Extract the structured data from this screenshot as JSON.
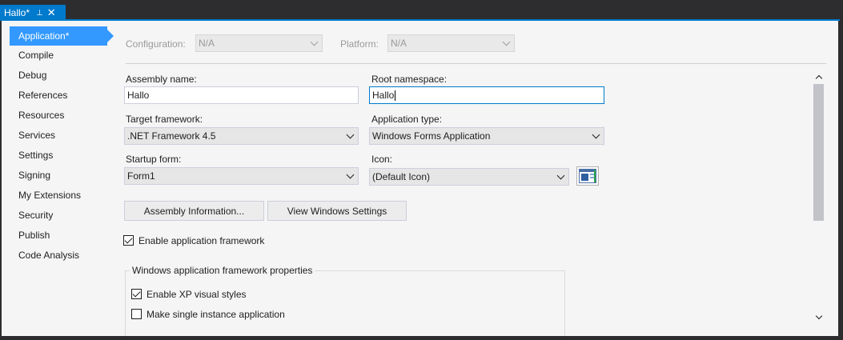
{
  "tab": {
    "title": "Hallo*",
    "pin_glyph": "⊣",
    "close_glyph": "✕"
  },
  "nav": {
    "items": [
      {
        "label": "Application*",
        "active": true
      },
      {
        "label": "Compile"
      },
      {
        "label": "Debug"
      },
      {
        "label": "References"
      },
      {
        "label": "Resources"
      },
      {
        "label": "Services"
      },
      {
        "label": "Settings"
      },
      {
        "label": "Signing"
      },
      {
        "label": "My Extensions"
      },
      {
        "label": "Security"
      },
      {
        "label": "Publish"
      },
      {
        "label": "Code Analysis"
      }
    ]
  },
  "config": {
    "configuration_label": "Configuration:",
    "configuration_value": "N/A",
    "platform_label": "Platform:",
    "platform_value": "N/A"
  },
  "form": {
    "assembly_name_label": "Assembly name:",
    "assembly_name_value": "Hallo",
    "root_namespace_label": "Root namespace:",
    "root_namespace_value": "Hallo",
    "target_framework_label": "Target framework:",
    "target_framework_value": ".NET Framework 4.5",
    "application_type_label": "Application type:",
    "application_type_value": "Windows Forms Application",
    "startup_form_label": "Startup form:",
    "startup_form_value": "Form1",
    "icon_label": "Icon:",
    "icon_value": "(Default Icon)"
  },
  "buttons": {
    "assembly_info": "Assembly Information...",
    "view_windows_settings": "View Windows Settings"
  },
  "framework": {
    "enable_label": "Enable application framework",
    "enable_checked": true,
    "group_title": "Windows application framework properties",
    "xp_styles_label": "Enable XP visual styles",
    "xp_styles_checked": true,
    "single_instance_label": "Make single instance application",
    "single_instance_checked": false
  },
  "colors": {
    "accent": "#007acc",
    "selection": "#3399ff",
    "chrome": "#2d2d30",
    "panel": "#f5f5f5"
  }
}
